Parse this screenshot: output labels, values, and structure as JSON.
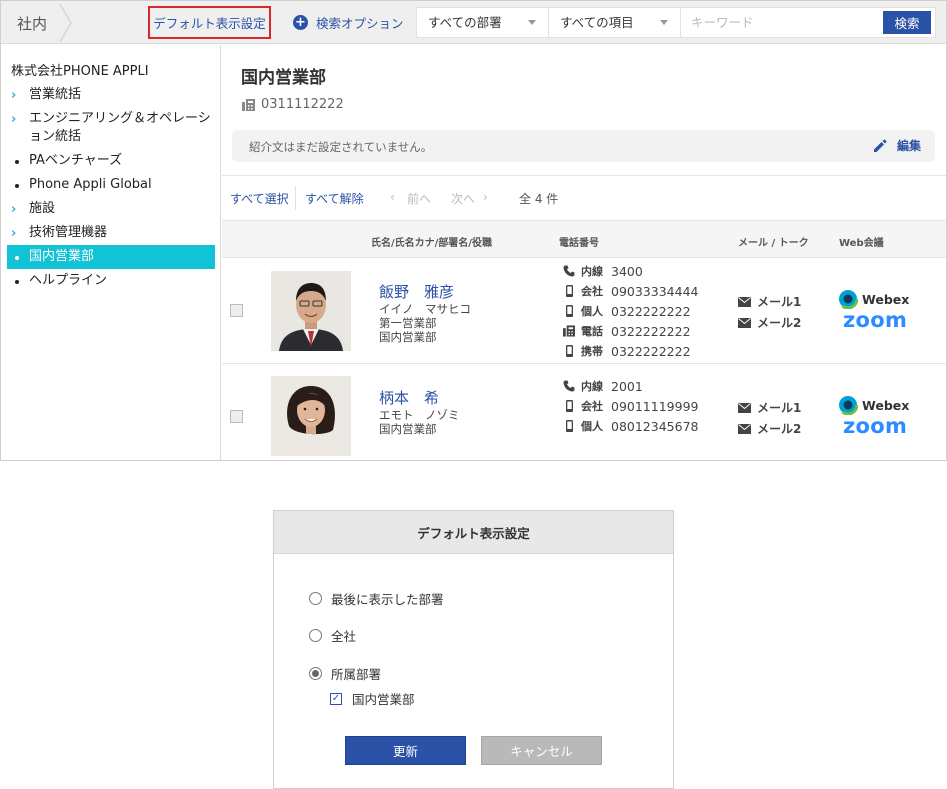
{
  "topbar": {
    "breadcrumb": "社内",
    "default_display_button": "デフォルト表示設定",
    "search_option_label": "検索オプション",
    "department_select": "すべての部署",
    "item_select": "すべての項目",
    "keyword_placeholder": "キーワード",
    "search_button": "検索"
  },
  "sidebar": {
    "company": "株式会社PHONE APPLI",
    "items": [
      {
        "label": "営業統括",
        "type": "expandable",
        "active": false
      },
      {
        "label": "エンジニアリング＆オペレーション統括",
        "type": "expandable",
        "active": false
      },
      {
        "label": "PAベンチャーズ",
        "type": "leaf",
        "active": false
      },
      {
        "label": "Phone Appli Global",
        "type": "leaf",
        "active": false
      },
      {
        "label": "施設",
        "type": "expandable",
        "active": false
      },
      {
        "label": "技術管理機器",
        "type": "expandable",
        "active": false
      },
      {
        "label": "国内営業部",
        "type": "leaf",
        "active": true
      },
      {
        "label": "ヘルプライン",
        "type": "leaf",
        "active": false
      }
    ]
  },
  "department": {
    "title": "国内営業部",
    "phone": "0311112222",
    "intro": "紹介文はまだ設定されていません。",
    "edit_label": "編集"
  },
  "pager": {
    "select_all": "すべて選択",
    "deselect_all": "すべて解除",
    "prev": "前へ",
    "next": "次へ",
    "count": "全 4 件"
  },
  "table": {
    "headers": {
      "name": "氏名/氏名カナ/部署名/役職",
      "phone": "電話番号",
      "mail": "メール / トーク",
      "web": "Web会議"
    },
    "rows": [
      {
        "name": "飯野　雅彦",
        "kana": "イイノ　マサヒコ",
        "dept1": "第一営業部",
        "dept2": "国内営業部",
        "phones": [
          {
            "label": "内線",
            "number": "3400",
            "icon": "phone-icon"
          },
          {
            "label": "会社",
            "number": "09033334444",
            "icon": "mobile-icon"
          },
          {
            "label": "個人",
            "number": "0322222222",
            "icon": "mobile-icon"
          },
          {
            "label": "電話",
            "number": "0322222222",
            "icon": "fax-icon"
          },
          {
            "label": "携帯",
            "number": "0322222222",
            "icon": "mobile-icon"
          }
        ],
        "mail1": "メール1",
        "mail2": "メール2",
        "webex": "Webex",
        "zoom": "zoom"
      },
      {
        "name": "柄本　希",
        "kana": "エモト　ノゾミ",
        "dept1": "国内営業部",
        "phones": [
          {
            "label": "内線",
            "number": "2001",
            "icon": "phone-icon"
          },
          {
            "label": "会社",
            "number": "09011119999",
            "icon": "mobile-icon"
          },
          {
            "label": "個人",
            "number": "08012345678",
            "icon": "mobile-icon"
          }
        ],
        "mail1": "メール1",
        "mail2": "メール2",
        "webex": "Webex",
        "zoom": "zoom"
      }
    ]
  },
  "dialog": {
    "title": "デフォルト表示設定",
    "options": [
      {
        "label": "最後に表示した部署",
        "selected": false
      },
      {
        "label": "全社",
        "selected": false
      },
      {
        "label": "所属部署",
        "selected": true
      }
    ],
    "checkbox_label": "国内営業部",
    "checkbox_checked": true,
    "update_button": "更新",
    "cancel_button": "キャンセル"
  },
  "colors": {
    "accent": "#2a52a6",
    "active_item": "#12c3d6",
    "highlight_border": "#d32b2b",
    "zoom_blue": "#2d8cff"
  }
}
